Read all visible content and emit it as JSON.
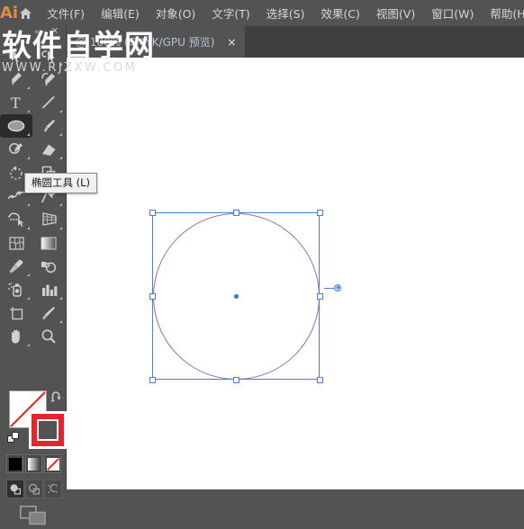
{
  "app": {
    "logo_text": "Ai",
    "home_icon": "home-icon"
  },
  "menubar": {
    "items": [
      {
        "label": "文件(F)",
        "name": "menu-file"
      },
      {
        "label": "编辑(E)",
        "name": "menu-edit"
      },
      {
        "label": "对象(O)",
        "name": "menu-object"
      },
      {
        "label": "文字(T)",
        "name": "menu-type"
      },
      {
        "label": "选择(S)",
        "name": "menu-select"
      },
      {
        "label": "效果(C)",
        "name": "menu-effect"
      },
      {
        "label": "视图(V)",
        "name": "menu-view"
      },
      {
        "label": "窗口(W)",
        "name": "menu-window"
      },
      {
        "label": "帮助(H)",
        "name": "menu-help"
      }
    ]
  },
  "document_tab": {
    "title": "@ 100% (CMYK/GPU 预览)",
    "close_label": "×"
  },
  "toolbar": {
    "collapse_label": "««",
    "close_label": "×",
    "tools": [
      {
        "name": "selection-tool",
        "icon": "arrow-cursor-icon",
        "active": false,
        "corner": false
      },
      {
        "name": "direct-selection-tool",
        "icon": "direct-select-cursor-icon",
        "active": false,
        "corner": true
      },
      {
        "name": "pen-tool",
        "icon": "pen-icon",
        "active": false,
        "corner": true
      },
      {
        "name": "curvature-tool",
        "icon": "curvature-pen-icon",
        "active": false,
        "corner": false
      },
      {
        "name": "type-tool",
        "icon": "text-t-icon",
        "active": false,
        "corner": true
      },
      {
        "name": "line-segment-tool",
        "icon": "line-icon",
        "active": false,
        "corner": true
      },
      {
        "name": "ellipse-tool",
        "icon": "ellipse-icon",
        "active": true,
        "corner": true
      },
      {
        "name": "paintbrush-tool",
        "icon": "paintbrush-icon",
        "active": false,
        "corner": true
      },
      {
        "name": "shaper-tool",
        "icon": "shaper-pencil-icon",
        "active": false,
        "corner": true
      },
      {
        "name": "eraser-tool",
        "icon": "eraser-icon",
        "active": false,
        "corner": true
      },
      {
        "name": "rotate-tool",
        "icon": "rotate-icon",
        "active": false,
        "corner": true
      },
      {
        "name": "scale-tool",
        "icon": "scale-icon",
        "active": false,
        "corner": true
      },
      {
        "name": "width-tool",
        "icon": "width-warp-icon",
        "active": false,
        "corner": true
      },
      {
        "name": "free-transform-tool",
        "icon": "pushpin-icon",
        "active": false,
        "corner": true
      },
      {
        "name": "shape-builder-tool",
        "icon": "shape-builder-icon",
        "active": false,
        "corner": true
      },
      {
        "name": "perspective-grid-tool",
        "icon": "perspective-grid-icon",
        "active": false,
        "corner": true
      },
      {
        "name": "mesh-tool",
        "icon": "mesh-icon",
        "active": false,
        "corner": false
      },
      {
        "name": "gradient-tool",
        "icon": "gradient-icon",
        "active": false,
        "corner": false
      },
      {
        "name": "eyedropper-tool",
        "icon": "eyedropper-icon",
        "active": false,
        "corner": true
      },
      {
        "name": "blend-tool",
        "icon": "blend-icon",
        "active": false,
        "corner": false
      },
      {
        "name": "symbol-sprayer-tool",
        "icon": "symbol-sprayer-icon",
        "active": false,
        "corner": true
      },
      {
        "name": "column-graph-tool",
        "icon": "bar-chart-icon",
        "active": false,
        "corner": true
      },
      {
        "name": "artboard-tool",
        "icon": "artboard-icon",
        "active": false,
        "corner": false
      },
      {
        "name": "slice-tool",
        "icon": "slice-knife-icon",
        "active": false,
        "corner": true
      },
      {
        "name": "hand-tool",
        "icon": "hand-icon",
        "active": false,
        "corner": true
      },
      {
        "name": "zoom-tool",
        "icon": "magnifier-icon",
        "active": false,
        "corner": false
      }
    ],
    "tooltip": "椭圆工具 (L)"
  },
  "color_controls": {
    "fill_name": "fill-swatch",
    "fill_color": "#ffffff",
    "fill_is_none": true,
    "stroke_name": "stroke-swatch",
    "stroke_color": "#e8232a",
    "swap_icon": "swap-fill-stroke-icon",
    "default_icon": "default-fill-stroke-icon",
    "modes": [
      {
        "name": "color-mode-button",
        "icon": "solid-color-icon"
      },
      {
        "name": "gradient-mode-button",
        "icon": "gradient-swatch-icon"
      },
      {
        "name": "none-mode-button",
        "icon": "none-slash-icon"
      }
    ],
    "draw_modes": [
      {
        "name": "draw-normal-button",
        "icon": "draw-normal-icon",
        "selected": true
      },
      {
        "name": "draw-behind-button",
        "icon": "draw-behind-icon",
        "selected": false
      },
      {
        "name": "draw-inside-button",
        "icon": "draw-inside-icon",
        "selected": false
      }
    ],
    "screen_mode": {
      "name": "change-screen-mode-button",
      "icon": "screen-mode-icon"
    }
  },
  "artwork": {
    "shape_name": "ellipse-shape",
    "shape_stroke_color": "#9a6ba8",
    "selection_color": "#4a7fd4",
    "handles": [
      {
        "name": "handle-top-left"
      },
      {
        "name": "handle-top-center"
      },
      {
        "name": "handle-top-right"
      },
      {
        "name": "handle-middle-left"
      },
      {
        "name": "handle-middle-right"
      },
      {
        "name": "handle-bottom-left"
      },
      {
        "name": "handle-bottom-center"
      },
      {
        "name": "handle-bottom-right"
      }
    ],
    "center_point_name": "shape-center-point",
    "widget_name": "transform-rotate-widget"
  },
  "watermark": {
    "main": "软件自学网",
    "sub": "WWW.RJZXW.COM"
  }
}
